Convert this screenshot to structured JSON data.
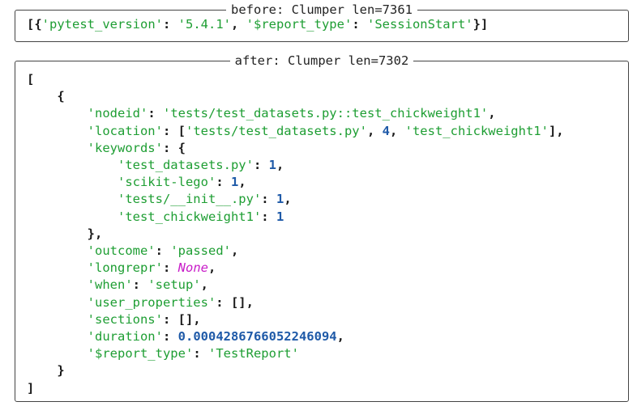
{
  "before": {
    "title": "before: Clumper len=7361",
    "line": {
      "key1": "'pytest_version'",
      "val1": "'5.4.1'",
      "key2": "'$report_type'",
      "val2": "'SessionStart'"
    }
  },
  "after": {
    "title": "after: Clumper len=7302",
    "record": {
      "nodeid_key": "'nodeid'",
      "nodeid_val": "'tests/test_datasets.py::test_chickweight1'",
      "location_key": "'location'",
      "location_val0": "'tests/test_datasets.py'",
      "location_val1": "4",
      "location_val2": "'test_chickweight1'",
      "keywords_key": "'keywords'",
      "keywords": [
        {
          "key": "'test_datasets.py'",
          "val": "1"
        },
        {
          "key": "'scikit-lego'",
          "val": "1"
        },
        {
          "key": "'tests/__init__.py'",
          "val": "1"
        },
        {
          "key": "'test_chickweight1'",
          "val": "1"
        }
      ],
      "outcome_key": "'outcome'",
      "outcome_val": "'passed'",
      "longrepr_key": "'longrepr'",
      "longrepr_val": "None",
      "when_key": "'when'",
      "when_val": "'setup'",
      "user_properties_key": "'user_properties'",
      "sections_key": "'sections'",
      "duration_key": "'duration'",
      "duration_val": "0.0004286766052246094",
      "report_type_key": "'$report_type'",
      "report_type_val": "'TestReport'"
    }
  },
  "colors": {
    "string": "#1e9e33",
    "number": "#1f5aa8",
    "none": "#c81cc8",
    "border": "#444444"
  }
}
